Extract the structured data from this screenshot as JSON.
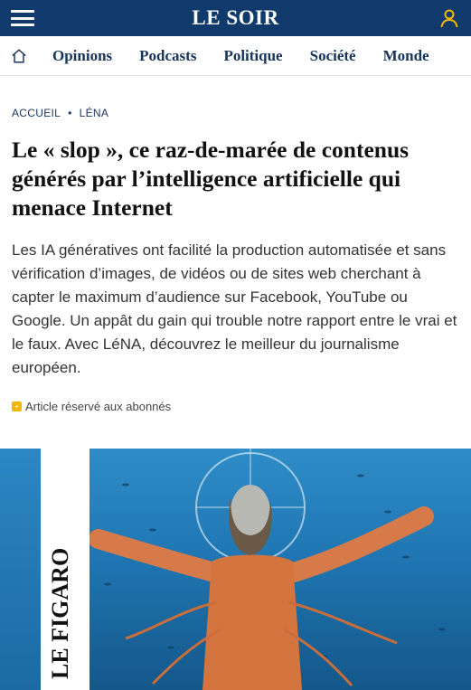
{
  "header": {
    "logo": "LE SOIR",
    "menu_icon": "hamburger-menu-icon",
    "account_icon": "user-icon"
  },
  "nav": {
    "home_icon": "home-icon",
    "items": [
      "Opinions",
      "Podcasts",
      "Politique",
      "Société",
      "Monde"
    ]
  },
  "article": {
    "breadcrumb": [
      "ACCUEIL",
      "LÉNA"
    ],
    "breadcrumb_separator": "•",
    "title": "Le « slop », ce raz-de-marée de contenus générés par l’intelligence artificielle qui menace Internet",
    "lead": "Les IA génératives ont facilité la production automatisée et sans vérification d’images, de vidéos ou de sites web cherchant à capter le maximum d’audience sur Facebook, YouTube ou Google. Un appât du gain qui trouble notre rapport entre le vrai et le faux. Avec LéNA, découvrez le meilleur du journalisme européen.",
    "subscriber_badge": "Article réservé aux abonnés",
    "image_caption_text": "LE FIGARO"
  },
  "colors": {
    "header_bg": "#0f3a6b",
    "nav_text": "#17345c",
    "badge": "#f2b705",
    "account_icon": "#f2b705"
  }
}
